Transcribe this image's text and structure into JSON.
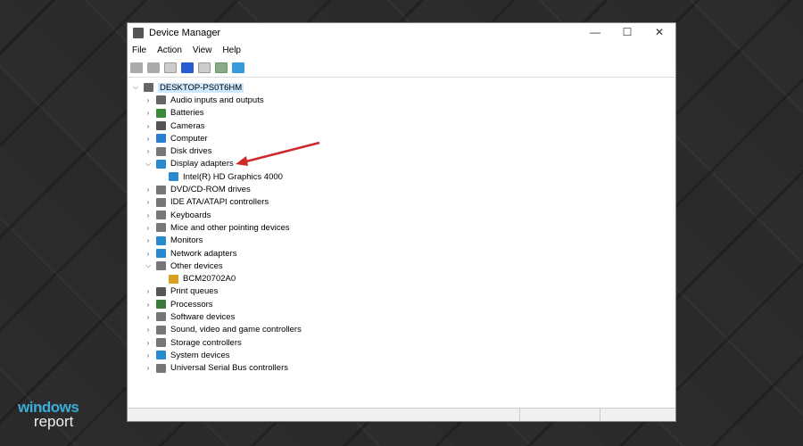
{
  "window": {
    "title": "Device Manager",
    "controls": {
      "minimize": "—",
      "maximize": "☐",
      "close": "✕"
    }
  },
  "menu": [
    "File",
    "Action",
    "View",
    "Help"
  ],
  "tree": {
    "root": "DESKTOP-PS0T6HM",
    "items": [
      {
        "label": "Audio inputs and outputs",
        "expanded": false,
        "color": "#666"
      },
      {
        "label": "Batteries",
        "expanded": false,
        "color": "#3a8a3a"
      },
      {
        "label": "Cameras",
        "expanded": false,
        "color": "#555"
      },
      {
        "label": "Computer",
        "expanded": false,
        "color": "#2a7fd0"
      },
      {
        "label": "Disk drives",
        "expanded": false,
        "color": "#777"
      },
      {
        "label": "Display adapters",
        "expanded": true,
        "color": "#2a8ad0",
        "children": [
          "Intel(R) HD Graphics 4000"
        ]
      },
      {
        "label": "DVD/CD-ROM drives",
        "expanded": false,
        "color": "#777"
      },
      {
        "label": "IDE ATA/ATAPI controllers",
        "expanded": false,
        "color": "#777"
      },
      {
        "label": "Keyboards",
        "expanded": false,
        "color": "#777"
      },
      {
        "label": "Mice and other pointing devices",
        "expanded": false,
        "color": "#777"
      },
      {
        "label": "Monitors",
        "expanded": false,
        "color": "#2a8ad0"
      },
      {
        "label": "Network adapters",
        "expanded": false,
        "color": "#2a8ad0"
      },
      {
        "label": "Other devices",
        "expanded": true,
        "color": "#777",
        "children": [
          "BCM20702A0"
        ]
      },
      {
        "label": "Print queues",
        "expanded": false,
        "color": "#555"
      },
      {
        "label": "Processors",
        "expanded": false,
        "color": "#3a7a3a"
      },
      {
        "label": "Software devices",
        "expanded": false,
        "color": "#777"
      },
      {
        "label": "Sound, video and game controllers",
        "expanded": false,
        "color": "#777"
      },
      {
        "label": "Storage controllers",
        "expanded": false,
        "color": "#777"
      },
      {
        "label": "System devices",
        "expanded": false,
        "color": "#2a8ad0"
      },
      {
        "label": "Universal Serial Bus controllers",
        "expanded": false,
        "color": "#777"
      }
    ]
  },
  "annotation_color": "#d0282a",
  "watermark": {
    "line1": "windows",
    "line2": "report"
  }
}
